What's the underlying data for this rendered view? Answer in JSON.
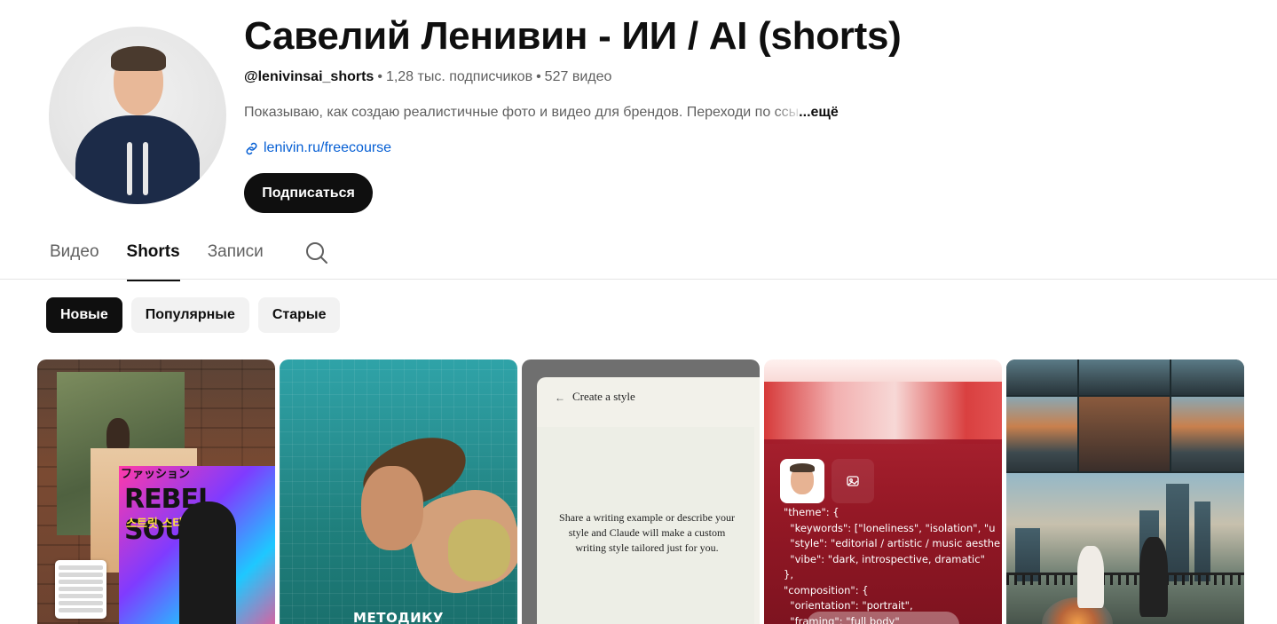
{
  "channel": {
    "title": "Савелий Ленивин - ИИ / AI (shorts)",
    "handle": "@lenivinsai_shorts",
    "subscribers": "1,28 тыс. подписчиков",
    "videos": "527 видео",
    "description": "Показываю, как создаю реалистичные фото и видео для брендов. Переходи по ",
    "description_faded": "ссы",
    "more_label": "...ещё",
    "link_text": "lenivin.ru/freecourse",
    "subscribe_label": "Подписаться"
  },
  "tabs": [
    {
      "label": "Видео",
      "active": false
    },
    {
      "label": "Shorts",
      "active": true
    },
    {
      "label": "Записи",
      "active": false
    }
  ],
  "icons": {
    "search": "search-icon",
    "link": "link-icon"
  },
  "chips": [
    {
      "label": "Новые",
      "active": true
    },
    {
      "label": "Популярные",
      "active": false
    },
    {
      "label": "Старые",
      "active": false
    }
  ],
  "shorts": [
    {
      "magazine_title": "REBEL SOUL",
      "magazine_korean": "스트릿 스타일",
      "magazine_japanese": "ファッション"
    },
    {
      "caption": "МЕТОДИКУ"
    },
    {
      "back_arrow": "←",
      "panel_title": "Create a style",
      "panel_text": "Share a writing example or describe your style and Claude will make a custom writing style tailored just for you."
    },
    {
      "code": "\"theme\": {\n  \"keywords\": [\"loneliness\", \"isolation\", \"u\n  \"style\": \"editorial / artistic / music aesthe\n  \"vibe\": \"dark, introspective, dramatic\"\n},\n\"composition\": {\n  \"orientation\": \"portrait\",\n  \"framing\": \"full body\""
    },
    {}
  ],
  "colors": {
    "link": "#065fd4",
    "text_secondary": "#606060",
    "chip_bg": "#f2f2f2",
    "dark": "#0f0f0f"
  }
}
